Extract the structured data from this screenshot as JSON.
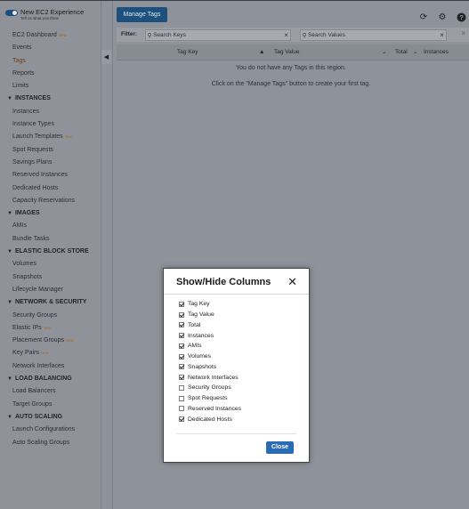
{
  "experience_toggle": {
    "title": "New EC2 Experience",
    "subtitle": "Tell us what you think"
  },
  "sidebar": {
    "top_items": [
      {
        "label": "EC2 Dashboard",
        "badge": "New"
      },
      {
        "label": "Events"
      },
      {
        "label": "Tags",
        "active": true
      },
      {
        "label": "Reports"
      },
      {
        "label": "Limits"
      }
    ],
    "sections": [
      {
        "title": "INSTANCES",
        "items": [
          {
            "label": "Instances"
          },
          {
            "label": "Instance Types"
          },
          {
            "label": "Launch Templates",
            "badge": "New"
          },
          {
            "label": "Spot Requests"
          },
          {
            "label": "Savings Plans"
          },
          {
            "label": "Reserved Instances"
          },
          {
            "label": "Dedicated Hosts"
          },
          {
            "label": "Capacity Reservations"
          }
        ]
      },
      {
        "title": "IMAGES",
        "items": [
          {
            "label": "AMIs"
          },
          {
            "label": "Bundle Tasks"
          }
        ]
      },
      {
        "title": "ELASTIC BLOCK STORE",
        "items": [
          {
            "label": "Volumes"
          },
          {
            "label": "Snapshots"
          },
          {
            "label": "Lifecycle Manager"
          }
        ]
      },
      {
        "title": "NETWORK & SECURITY",
        "items": [
          {
            "label": "Security Groups"
          },
          {
            "label": "Elastic IPs",
            "badge": "New"
          },
          {
            "label": "Placement Groups",
            "badge": "New"
          },
          {
            "label": "Key Pairs",
            "badge": "New"
          },
          {
            "label": "Network Interfaces"
          }
        ]
      },
      {
        "title": "LOAD BALANCING",
        "items": [
          {
            "label": "Load Balancers"
          },
          {
            "label": "Target Groups"
          }
        ]
      },
      {
        "title": "AUTO SCALING",
        "items": [
          {
            "label": "Launch Configurations"
          },
          {
            "label": "Auto Scaling Groups"
          }
        ]
      }
    ]
  },
  "toolbar": {
    "manage_tags_label": "Manage Tags",
    "icons": [
      "refresh-icon",
      "gear-icon",
      "help-icon"
    ]
  },
  "filter": {
    "label": "Filter:",
    "keys_placeholder": "Search Keys",
    "values_placeholder": "Search Values"
  },
  "table": {
    "columns": [
      "Tag Key",
      "Tag Value",
      "Total",
      "Instances"
    ],
    "empty_message": "You do not have any Tags in this region.",
    "empty_hint": "Click on the \"Manage Tags\" button to create your first tag."
  },
  "modal": {
    "title": "Show/Hide Columns",
    "options": [
      {
        "label": "Tag Key",
        "checked": true
      },
      {
        "label": "Tag Value",
        "checked": true
      },
      {
        "label": "Total",
        "checked": true
      },
      {
        "label": "Instances",
        "checked": true
      },
      {
        "label": "AMIs",
        "checked": true
      },
      {
        "label": "Volumes",
        "checked": true
      },
      {
        "label": "Snapshots",
        "checked": true
      },
      {
        "label": "Network Interfaces",
        "checked": true
      },
      {
        "label": "Security Groups",
        "checked": false
      },
      {
        "label": "Spot Requests",
        "checked": false
      },
      {
        "label": "Reserved Instances",
        "checked": false
      },
      {
        "label": "Dedicated Hosts",
        "checked": true
      }
    ],
    "close_label": "Close"
  },
  "colors": {
    "primary_button": "#2a6cb4",
    "manage_button": "#1e507d",
    "new_badge": "#a76a27"
  }
}
